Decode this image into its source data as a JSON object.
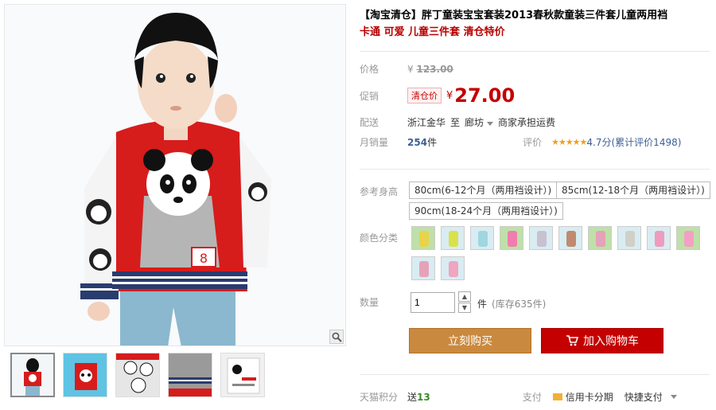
{
  "product": {
    "title": "【淘宝清仓】胖丁童装宝宝套装2013春秋款童装三件套儿童两用裆",
    "subtitle": "卡通 可爱 儿童三件套 清仓特价"
  },
  "price": {
    "label": "价格",
    "currency": "¥",
    "original": "123.00"
  },
  "promo": {
    "label": "促销",
    "badge": "清仓价",
    "currency": "¥",
    "value": "27.00"
  },
  "shipping": {
    "label": "配送",
    "from": "浙江金华",
    "to_word": "至",
    "to": "廊坊",
    "fee_note": "商家承担运费"
  },
  "sales": {
    "label": "月销量",
    "count": "254",
    "unit": "件",
    "review_label": "评价",
    "stars": "★★★★★",
    "score": "4.7分",
    "total_reviews": "(累计评价1498)"
  },
  "sizes": {
    "label": "参考身高",
    "options": [
      "80cm(6-12个月（两用裆设计）)",
      "85cm(12-18个月（两用裆设计）)",
      "90cm(18-24个月（两用裆设计）)"
    ]
  },
  "colors": {
    "label": "颜色分类",
    "swatches": [
      "#e9d34a",
      "#d9e24a",
      "#9fd6e0",
      "#f07db0",
      "#c9c0d0",
      "#c08a70",
      "#e5a2b8",
      "#d0d0c8",
      "#ef9bc0",
      "#f3a0c5",
      "#e5a2b8",
      "#f0a5c0"
    ]
  },
  "quantity": {
    "label": "数量",
    "value": "1",
    "unit": "件",
    "stock": "(库存635件)"
  },
  "actions": {
    "buy": "立刻购买",
    "cart": "加入购物车"
  },
  "footer": {
    "points_label": "天猫积分",
    "points_prefix": "送",
    "points": "13",
    "pay_label": "支付",
    "credit": "信用卡分期",
    "express": "快捷支付"
  }
}
